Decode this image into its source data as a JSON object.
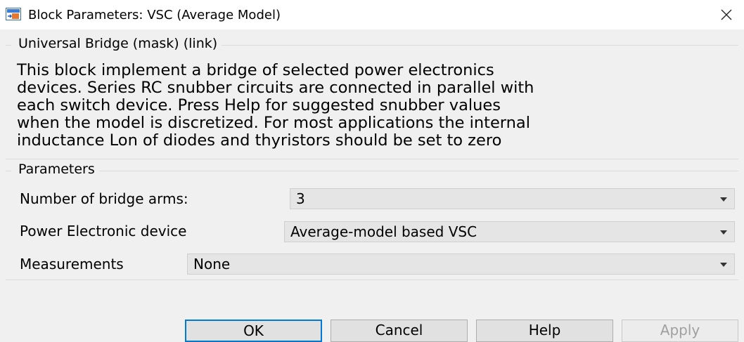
{
  "window": {
    "title": "Block Parameters: VSC (Average Model)",
    "icon": "simulink-block-icon",
    "close_icon": "close-icon"
  },
  "mask_group": {
    "legend": "Universal Bridge (mask) (link)",
    "description": "This block implement a bridge of selected power electronics\ndevices.  Series RC snubber circuits are connected in parallel with\neach switch device.  Press Help for suggested snubber values\nwhen the model is discretized. For most applications the internal\ninductance Lon of diodes and thyristors should be set to zero"
  },
  "parameters": {
    "legend": "Parameters",
    "fields": [
      {
        "label": "Number of bridge arms:",
        "value": "3"
      },
      {
        "label": "Power Electronic device",
        "value": "Average-model based VSC"
      },
      {
        "label": "Measurements",
        "value": "None"
      }
    ]
  },
  "buttons": {
    "ok": "OK",
    "cancel": "Cancel",
    "help": "Help",
    "apply": "Apply"
  }
}
